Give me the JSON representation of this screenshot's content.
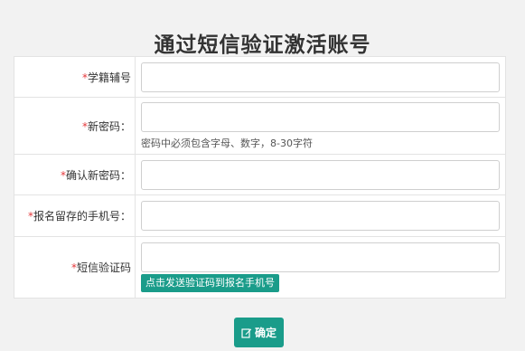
{
  "title": "通过短信验证激活账号",
  "form": {
    "required_mark": "*",
    "rows": [
      {
        "label": "学籍辅号",
        "value": "",
        "placeholder": ""
      },
      {
        "label": "新密码：",
        "value": "",
        "placeholder": "",
        "hint": "密码中必须包含字母、数字，8-30字符"
      },
      {
        "label": "确认新密码：",
        "value": "",
        "placeholder": ""
      },
      {
        "label": "报名留存的手机号：",
        "value": "",
        "placeholder": ""
      },
      {
        "label": "短信验证码",
        "value": "",
        "placeholder": "",
        "button": "点击发送验证码到报名手机号"
      }
    ]
  },
  "confirm": {
    "label": "确定",
    "icon": "edit-icon"
  },
  "colors": {
    "accent": "#1a9c8a",
    "required": "#e4393c",
    "background": "#f2f2f2"
  }
}
